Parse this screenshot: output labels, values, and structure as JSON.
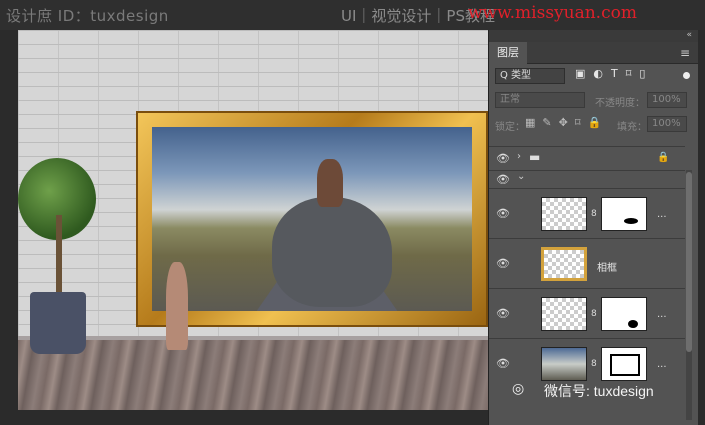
{
  "watermark": {
    "left": "设计庶 ID：tuxdesign",
    "right": "UI｜视觉设计｜PS教程",
    "url": "www.missyuan.com"
  },
  "panel": {
    "tab_label": "图层",
    "menu_icon": "≡",
    "filter": {
      "label": "Q 类型",
      "icons": "▣◐T⌑▯"
    },
    "blend": {
      "mode": "正常",
      "opacity_label": "不透明度：",
      "opacity": "100%"
    },
    "lock": {
      "label": "锁定：",
      "icons": "▦✎✥⌑🔒",
      "fill_label": "填充：",
      "fill": "100%"
    },
    "layers": [
      {
        "type": "group",
        "name": ""
      },
      {
        "type": "group-open",
        "name": ""
      },
      {
        "type": "layer-mask",
        "name": "..."
      },
      {
        "type": "layer",
        "name": "相框"
      },
      {
        "type": "layer-mask",
        "name": "..."
      },
      {
        "type": "layer-photo-mask",
        "name": "..."
      }
    ]
  },
  "icons": {
    "eye": "👁",
    "folder": "▬",
    "lock": "🔒",
    "chevron_right": "›",
    "chevron_down": "⌄",
    "link": "8",
    "wechat": "◎"
  },
  "wechat": {
    "label": "微信号: tuxdesign"
  },
  "colors": {
    "url_red": "#e0202a",
    "panel_bg": "#535353",
    "frame_gold": "#d3a23c"
  }
}
